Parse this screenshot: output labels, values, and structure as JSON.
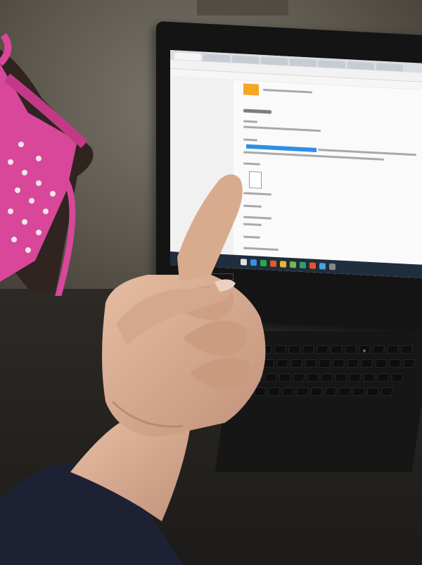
{
  "scene": {
    "description_visible": false
  },
  "laptop": {
    "screen_background": "#ececec",
    "taskbar_color": "#1f2d3d",
    "highlight_color": "#2b8fe8",
    "thumbnail_color": "#f5a623"
  },
  "colors": {
    "skin": "#d9ab8e",
    "skin_shadow": "#b88a6e",
    "sleeve": "#1c2233",
    "bag": "#d8479a",
    "bag_dots": "#f3e6ea",
    "lid": "#141414"
  },
  "icons": [
    "pointing-finger",
    "laptop",
    "pink-bag"
  ]
}
